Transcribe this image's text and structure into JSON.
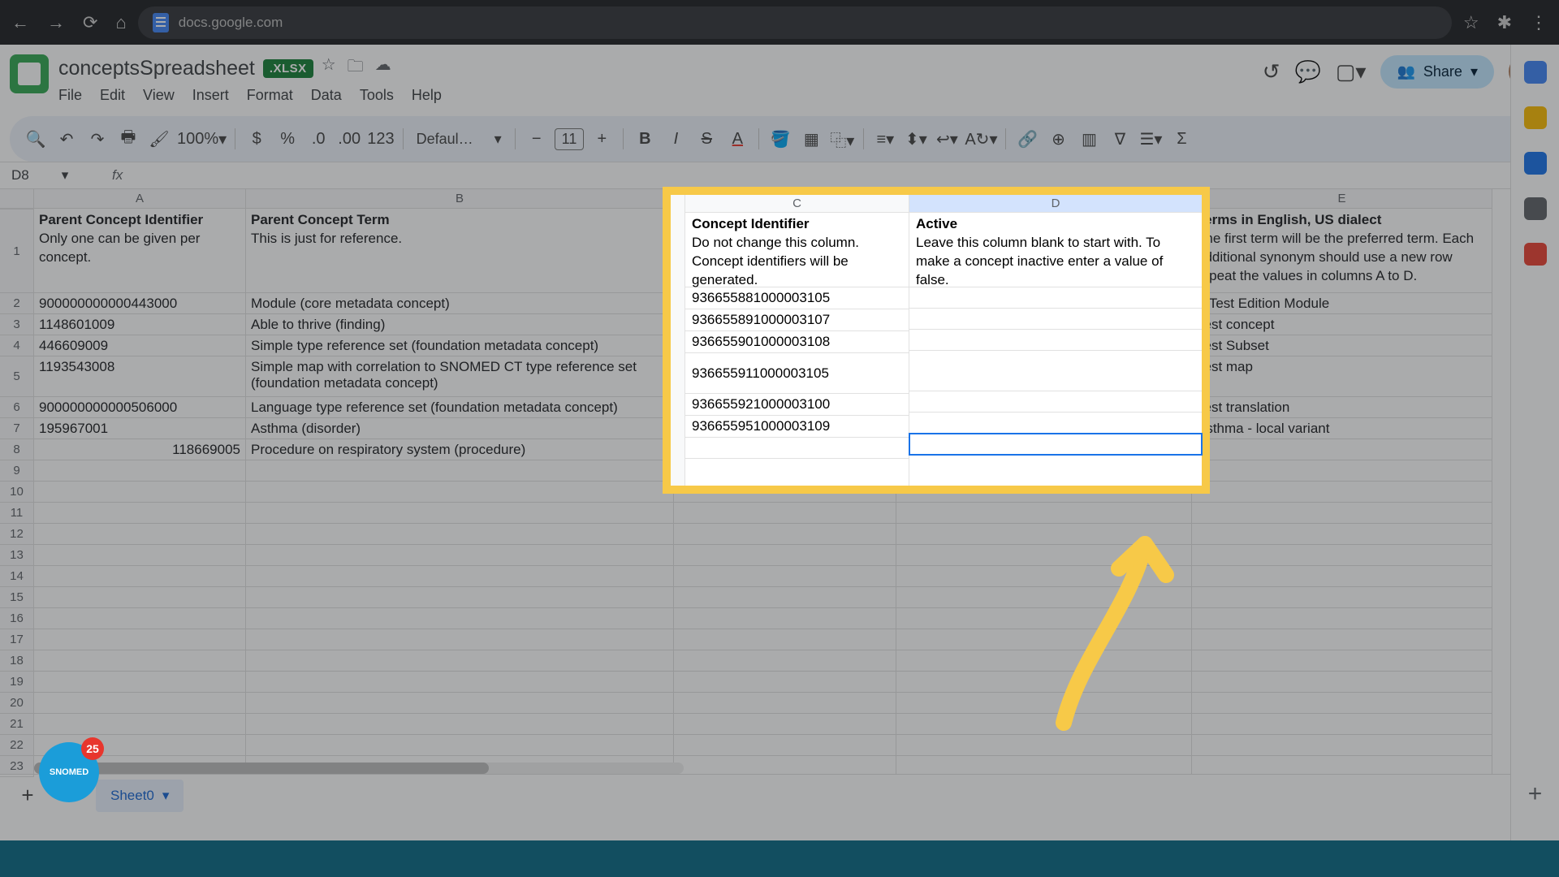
{
  "browser": {
    "url": "docs.google.com"
  },
  "doc": {
    "title": "conceptsSpreadsheet",
    "badge": ".XLSX"
  },
  "menubar": [
    "File",
    "Edit",
    "View",
    "Insert",
    "Format",
    "Data",
    "Tools",
    "Help"
  ],
  "share": "Share",
  "toolbar": {
    "zoom": "100%",
    "font": "Defaul…",
    "fontsize": "11",
    "numfmt": "123"
  },
  "namebox": "D8",
  "columns": [
    "A",
    "B",
    "C",
    "D",
    "E"
  ],
  "headers": {
    "A": {
      "b": "Parent Concept Identifier",
      "t": "Only one can be given per concept."
    },
    "B": {
      "b": "Parent Concept Term",
      "t": "This is just for reference."
    },
    "C": {
      "b": "Concept Identifier",
      "t": "Do not change this column. Concept identifiers will be generated."
    },
    "D": {
      "b": "Active",
      "t": "Leave this column blank to start with. To make a concept inactive enter a value of false."
    },
    "E": {
      "b": "Terms in English, US dialect",
      "t": "The first term will be the preferred term. Each additional synonym should use a new row repeat the values in columns A to D."
    }
  },
  "rows": [
    {
      "n": "2",
      "A": "900000000000443000",
      "B": "Module (core metadata concept)",
      "C": "936655881000003105",
      "D": "",
      "E": "A Test Edition Module"
    },
    {
      "n": "3",
      "A": "1148601009",
      "B": "Able to thrive (finding)",
      "C": "936655891000003107",
      "D": "",
      "E": "Test concept"
    },
    {
      "n": "4",
      "A": "446609009",
      "B": "Simple type reference set (foundation metadata concept)",
      "C": "936655901000003108",
      "D": "",
      "E": "Test Subset"
    },
    {
      "n": "5",
      "A": "1193543008",
      "B": "Simple map with correlation to SNOMED CT type reference set (foundation metadata concept)",
      "C": "936655911000003105",
      "D": "",
      "E": "Test map",
      "tall": true
    },
    {
      "n": "6",
      "A": "900000000000506000",
      "B": "Language type reference set (foundation metadata concept)",
      "C": "936655921000003100",
      "D": "",
      "E": "Test translation"
    },
    {
      "n": "7",
      "A": "195967001",
      "B": "Asthma (disorder)",
      "C": "936655951000003109",
      "D": "",
      "E": "Asthma - local variant"
    },
    {
      "n": "8",
      "A": "118669005",
      "Aralign": true,
      "B": "Procedure on respiratory system (procedure)",
      "C": "",
      "D": "",
      "E": "",
      "sel": "D"
    }
  ],
  "emptyRows": [
    "9",
    "10",
    "11",
    "12",
    "13",
    "14",
    "15",
    "16",
    "17",
    "18",
    "19",
    "20",
    "21",
    "22",
    "23"
  ],
  "sheetTab": "Sheet0",
  "snomed": {
    "label": "SNOMED",
    "badge": "25"
  }
}
